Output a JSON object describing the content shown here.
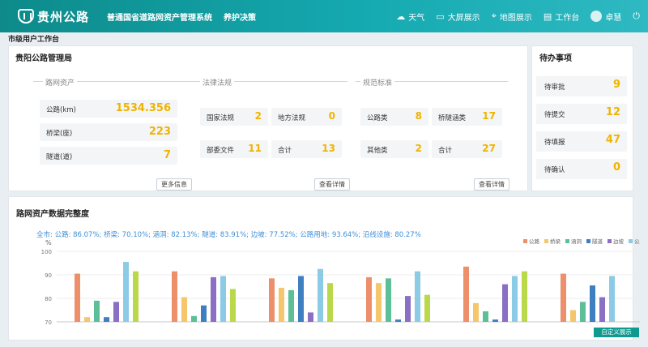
{
  "header": {
    "logo_text": "贵州公路",
    "system_name": "普通国省道路网资产管理系统",
    "menu": "养护决策",
    "nav": [
      {
        "icon": "cloud-icon",
        "glyph": "☁",
        "label": "天气"
      },
      {
        "icon": "monitor-icon",
        "glyph": "▭",
        "label": "大屏展示"
      },
      {
        "icon": "map-pin-icon",
        "glyph": "⌖",
        "label": "地图展示"
      },
      {
        "icon": "desk-icon",
        "glyph": "▤",
        "label": "工作台"
      }
    ],
    "user": "卓慧",
    "power_glyph": "⏻"
  },
  "breadcrumb": "市级用户工作台",
  "overview": {
    "title": "贵阳公路管理局",
    "road_assets": {
      "title": "路网资产",
      "items": [
        {
          "label": "公路(km)",
          "value": "1534.356"
        },
        {
          "label": "桥梁(座)",
          "value": "223"
        },
        {
          "label": "隧道(道)",
          "value": "7"
        }
      ],
      "button": "更多信息"
    },
    "laws": {
      "title": "法律法规",
      "items": [
        {
          "label": "国家法规",
          "value": "2"
        },
        {
          "label": "地方法规",
          "value": "0"
        },
        {
          "label": "部委文件",
          "value": "11"
        },
        {
          "label": "合计",
          "value": "13"
        }
      ],
      "button": "查看详情"
    },
    "standards": {
      "title": "规范标准",
      "items": [
        {
          "label": "公路类",
          "value": "8"
        },
        {
          "label": "桥隧涵类",
          "value": "17"
        },
        {
          "label": "其他类",
          "value": "2"
        },
        {
          "label": "合计",
          "value": "27"
        }
      ],
      "button": "查看详情"
    }
  },
  "todo": {
    "title": "待办事项",
    "items": [
      {
        "label": "待审批",
        "value": "9"
      },
      {
        "label": "待提交",
        "value": "12"
      },
      {
        "label": "待填报",
        "value": "47"
      },
      {
        "label": "待确认",
        "value": "0"
      }
    ]
  },
  "completeness": {
    "title": "路网资产数据完整度",
    "summary": "全市: 公路: 86.07%; 桥梁: 70.10%; 涵洞: 82.13%; 隧道: 83.91%; 边坡: 77.52%; 公路用地: 93.64%; 沿线设施: 80.27%",
    "unit": "%",
    "custom_button": "自定义展示"
  },
  "chart_data": {
    "type": "bar",
    "ylabel": "%",
    "ylim": [
      70,
      100
    ],
    "yticks": [
      "100",
      "90",
      "80",
      "70"
    ],
    "series": [
      {
        "name": "公路",
        "color": "#ec8f6a",
        "values": [
          90.5,
          91.5,
          88.5,
          89.0,
          93.5,
          90.5
        ]
      },
      {
        "name": "桥梁",
        "color": "#f5c66b",
        "values": [
          72.0,
          80.5,
          84.5,
          86.5,
          78.0,
          75.0
        ]
      },
      {
        "name": "涵洞",
        "color": "#5dbf98",
        "values": [
          79.0,
          72.5,
          83.5,
          88.5,
          74.5,
          78.5
        ]
      },
      {
        "name": "隧道",
        "color": "#3e7fc2",
        "values": [
          72.0,
          77.0,
          89.5,
          71.0,
          71.0,
          85.5
        ]
      },
      {
        "name": "边坡",
        "color": "#8a6fc4",
        "values": [
          78.5,
          89.0,
          74.0,
          81.0,
          86.0,
          80.5
        ]
      },
      {
        "name": "公路用地",
        "color": "#8ccbe6",
        "values": [
          95.5,
          89.5,
          92.5,
          91.5,
          89.5,
          89.5
        ]
      },
      {
        "name": "沿线设施",
        "color": "#b9d94a",
        "values": [
          91.5,
          84.0,
          86.5,
          81.5,
          91.5,
          null
        ]
      }
    ]
  }
}
